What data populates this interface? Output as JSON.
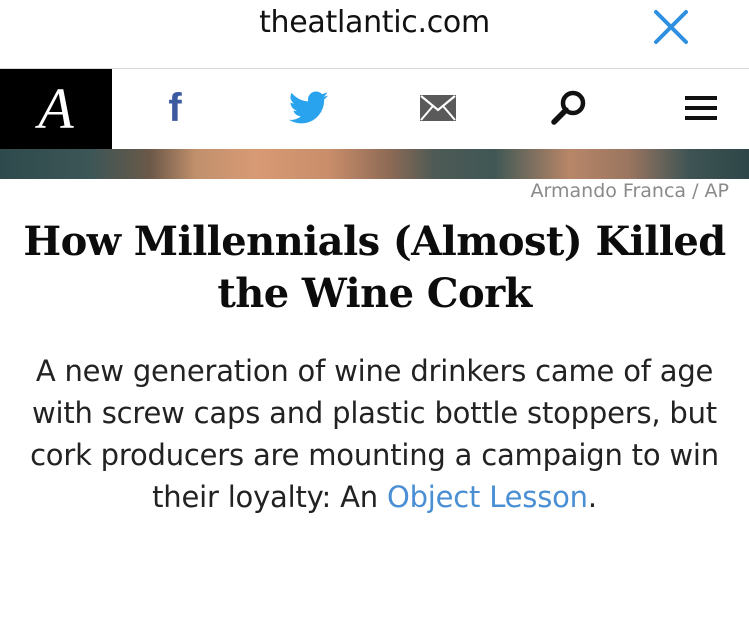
{
  "browser": {
    "url": "theatlantic.com",
    "close_icon": "close-icon",
    "accent_color": "#2f8fe0"
  },
  "nav": {
    "logo_letter": "A",
    "facebook_glyph": "f",
    "icons": [
      "facebook-icon",
      "twitter-icon",
      "mail-icon",
      "search-icon",
      "menu-icon"
    ],
    "facebook_color": "#3b5aa0",
    "twitter_color": "#2aa3ef",
    "mail_color": "#555555"
  },
  "article": {
    "photo_credit": "Armando Franca / AP",
    "headline": "How Millennials (Almost) Killed the Wine Cork",
    "dek_text": "A new generation of wine drinkers came of age with screw caps and plastic bottle stoppers, but cork producers are mounting a campaign to win their loyalty: An ",
    "dek_link": "Object Lesson",
    "dek_end": ".",
    "link_color": "#4a8fd4"
  }
}
